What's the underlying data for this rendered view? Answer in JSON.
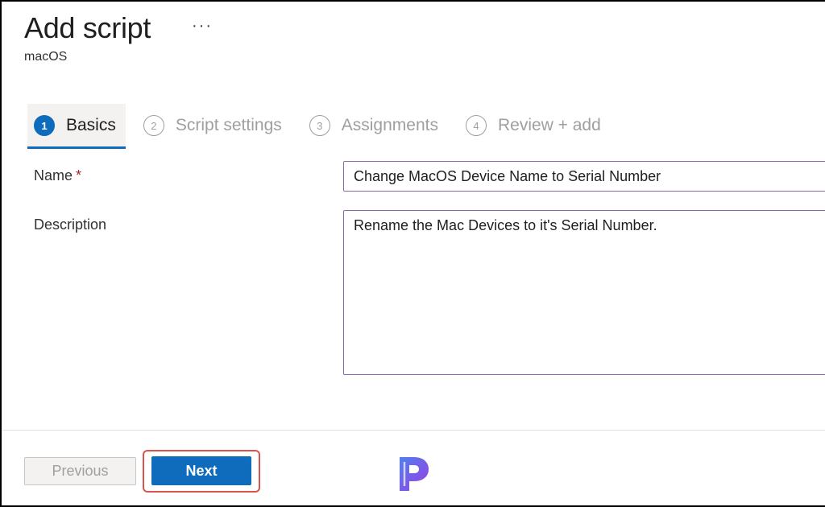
{
  "header": {
    "title": "Add script",
    "more_icon": "more-horizontal-icon",
    "subtitle": "macOS"
  },
  "wizard": {
    "steps": [
      {
        "number": "1",
        "label": "Basics",
        "active": true
      },
      {
        "number": "2",
        "label": "Script settings",
        "active": false
      },
      {
        "number": "3",
        "label": "Assignments",
        "active": false
      },
      {
        "number": "4",
        "label": "Review + add",
        "active": false
      }
    ]
  },
  "form": {
    "name_label": "Name",
    "required_marker": "*",
    "name_value": "Change MacOS Device Name to Serial Number",
    "description_label": "Description",
    "description_value": "Rename the Mac Devices to it's Serial Number."
  },
  "footer": {
    "previous_label": "Previous",
    "next_label": "Next"
  },
  "colors": {
    "accent": "#0f6cbd",
    "input_border": "#8a6aa8",
    "highlight": "#d9534f",
    "required": "#a4262c"
  }
}
